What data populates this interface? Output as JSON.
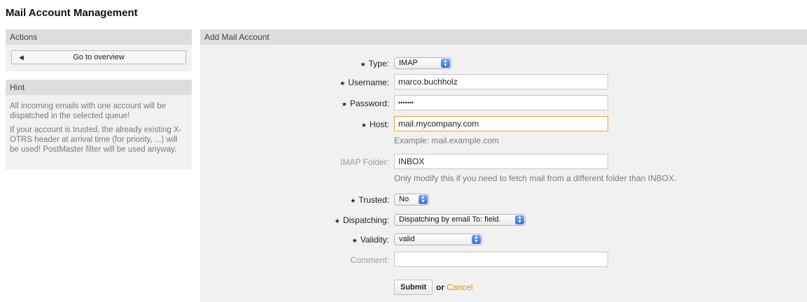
{
  "page": {
    "title": "Mail Account Management"
  },
  "sidebar": {
    "actions": {
      "header": "Actions",
      "overview_button": "Go to overview"
    },
    "hint": {
      "header": "Hint",
      "paragraphs": [
        "All incoming emails with one account will be dispatched in the selected queue!",
        "If your account is trusted, the already existing X-OTRS header at arrival time (for priority, ...) will be used! PostMaster filter will be used anyway."
      ]
    }
  },
  "form": {
    "header": "Add Mail Account",
    "type": {
      "label": "Type:",
      "value": "IMAP",
      "required": true
    },
    "username": {
      "label": "Username:",
      "value": "marco.buchholz",
      "required": true
    },
    "password": {
      "label": "Password:",
      "value": "•••••••",
      "required": true
    },
    "host": {
      "label": "Host:",
      "value": "mail.mycompany.com",
      "help": "Example: mail.example.com",
      "required": true
    },
    "imap_folder": {
      "label": "IMAP Folder:",
      "value": "INBOX",
      "help": "Only modify this if you need to fetch mail from a different folder than INBOX.",
      "required": false
    },
    "trusted": {
      "label": "Trusted:",
      "value": "No",
      "required": true
    },
    "dispatching": {
      "label": "Dispatching:",
      "value": "Dispatching by email To: field.",
      "required": true
    },
    "validity": {
      "label": "Validity:",
      "value": "valid",
      "required": true
    },
    "comment": {
      "label": "Comment:",
      "value": "",
      "required": false
    },
    "submit_label": "Submit",
    "or_text": "or",
    "cancel_label": "Cancel",
    "required_marker": "★"
  },
  "colors": {
    "accent_link": "#f08c00",
    "focus_border": "#f0a040",
    "panel_bg": "#f1f1f1",
    "header_bg": "#dddddd"
  }
}
